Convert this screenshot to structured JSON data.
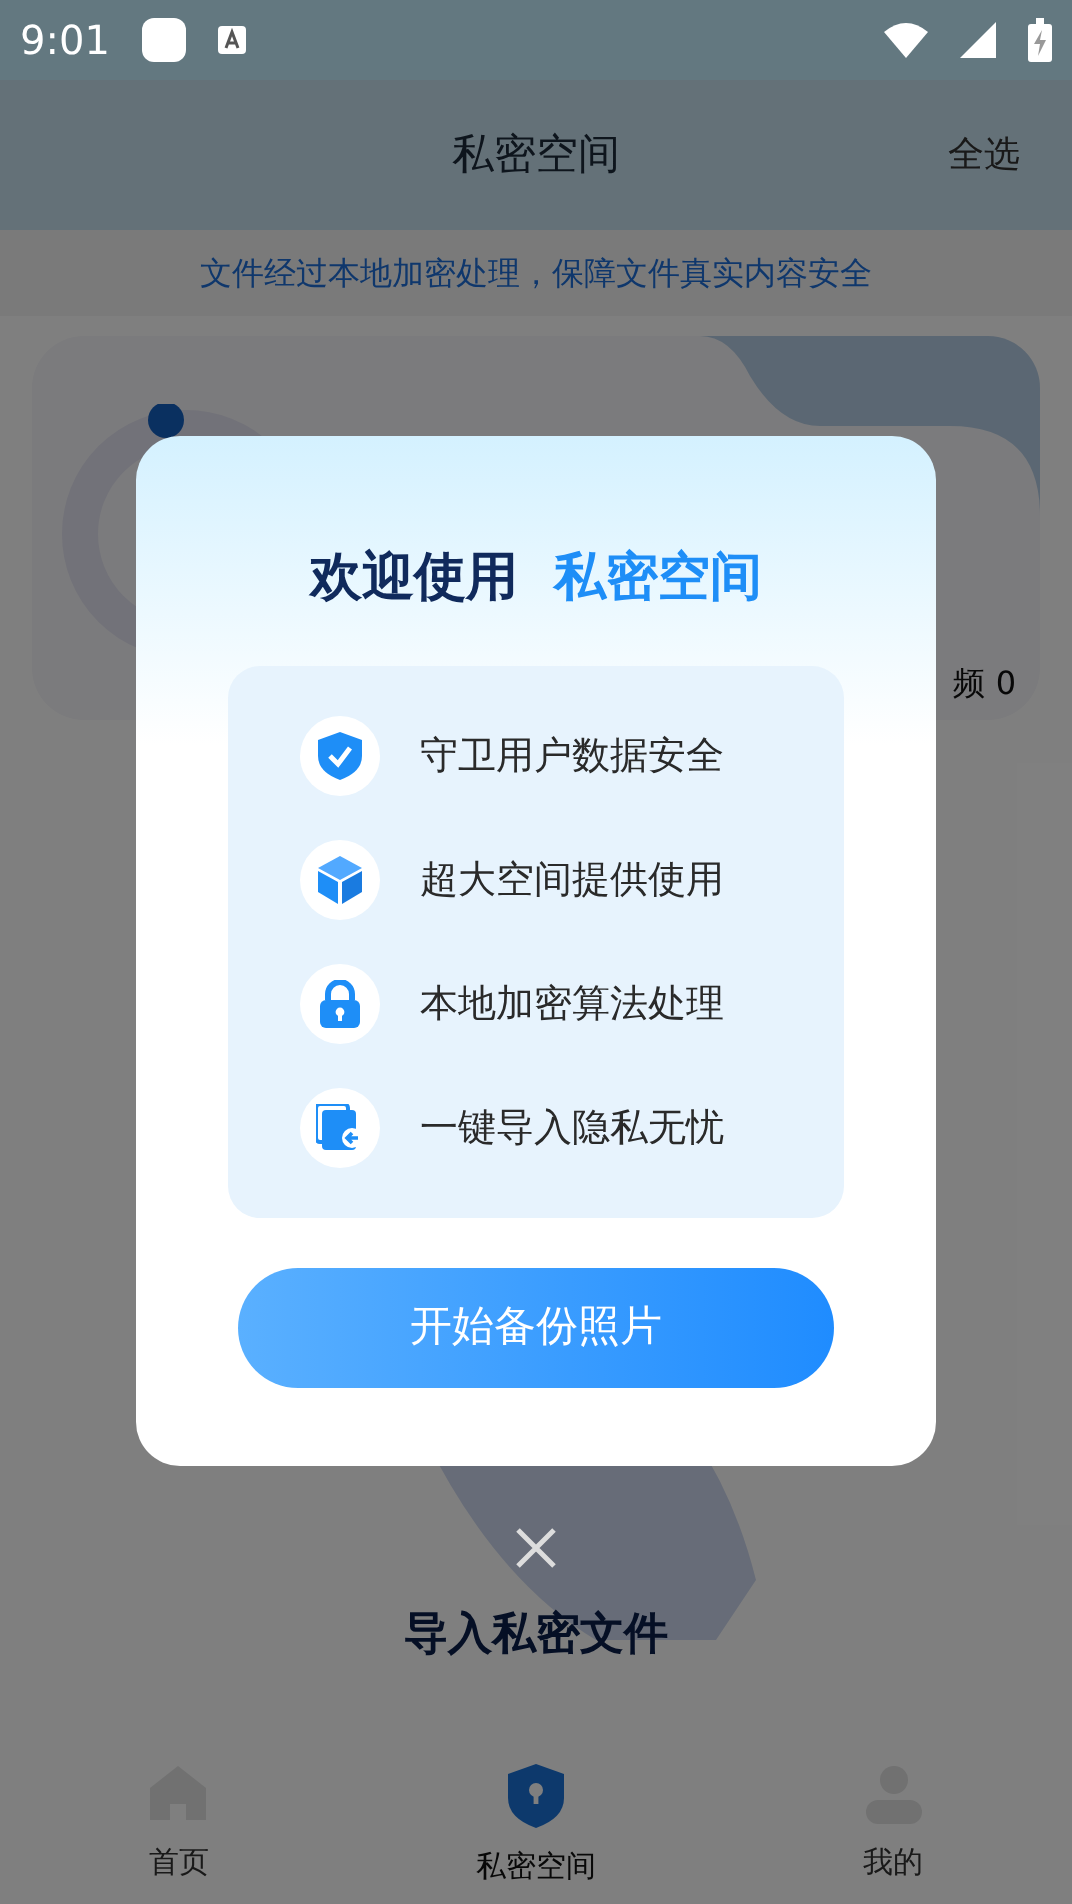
{
  "status_bar": {
    "time": "9:01"
  },
  "header": {
    "title": "私密空间",
    "action": "全选"
  },
  "notice": "文件经过本地加密处理，保障文件真实内容安全",
  "storage_card": {
    "stat": "频 0"
  },
  "import": {
    "title": "导入私密文件"
  },
  "tabs": [
    {
      "kind": "home",
      "label": "首页",
      "selected": false
    },
    {
      "kind": "vault",
      "label": "私密空间",
      "selected": true
    },
    {
      "kind": "profile",
      "label": "我的",
      "selected": false
    }
  ],
  "dialog": {
    "title": "欢迎使用",
    "highlight": "私密空间",
    "features": [
      {
        "kind": "shield",
        "text": "守卫用户数据安全"
      },
      {
        "kind": "cube",
        "text": "超大空间提供使用"
      },
      {
        "kind": "lock",
        "text": "本地加密算法处理"
      },
      {
        "kind": "import",
        "text": "一键导入隐私无忧"
      }
    ],
    "button": "开始备份照片"
  }
}
